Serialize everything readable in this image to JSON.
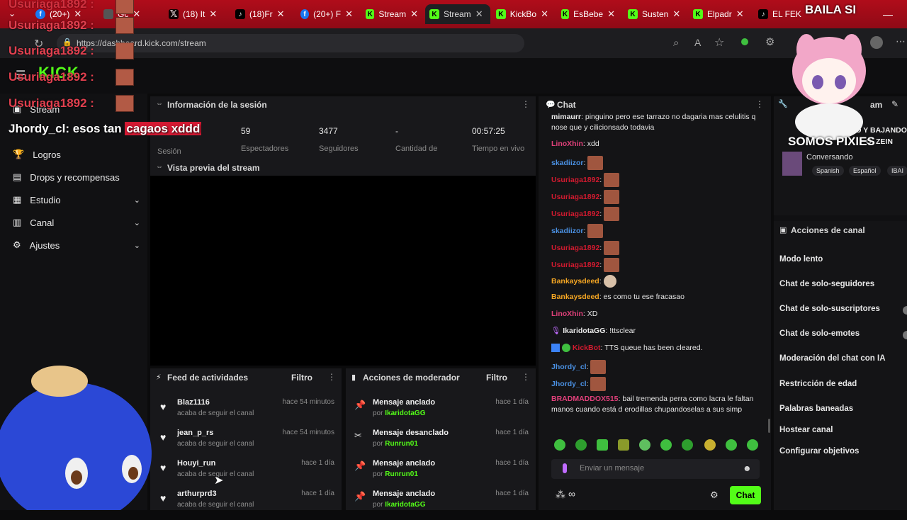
{
  "browser": {
    "tabs": [
      {
        "label": "(20+)",
        "icon": "facebook-icon"
      },
      {
        "label": "Gc",
        "icon": "generic-icon"
      },
      {
        "label": "(18) It",
        "icon": "x-icon"
      },
      {
        "label": "(18)Fr",
        "icon": "tiktok-icon"
      },
      {
        "label": "(20+) F",
        "icon": "facebook-icon"
      },
      {
        "label": "Stream",
        "icon": "kick-icon"
      },
      {
        "label": "Stream",
        "icon": "kick-icon"
      },
      {
        "label": "KickBo",
        "icon": "kick-icon"
      },
      {
        "label": "EsBebe",
        "icon": "kick-icon"
      },
      {
        "label": "Susten",
        "icon": "kick-icon"
      },
      {
        "label": "Elpadr",
        "icon": "kick-icon"
      },
      {
        "label": "EL FEK",
        "icon": "tiktok-icon"
      }
    ],
    "url": "https://dashboard.kick.com/stream"
  },
  "overlay": {
    "repeated_user": "Usuriaga1892 :",
    "jhordy_user": "Jhordy_cl",
    "jhordy_msg_part1": ": esos tan ",
    "jhordy_msg_part2": "cagaos xddd",
    "baila_si": "BAILA SI",
    "somos_pixies": "SOMOS PIXIES"
  },
  "sidebar": {
    "items": [
      {
        "label": "Stream",
        "icon": "stream-icon"
      },
      {
        "label": "Logros",
        "icon": "trophy-icon"
      },
      {
        "label": "Drops y recompensas",
        "icon": "gift-icon"
      },
      {
        "label": "Estudio",
        "icon": "studio-icon",
        "chevron": true
      },
      {
        "label": "Canal",
        "icon": "channel-icon",
        "chevron": true
      },
      {
        "label": "Ajustes",
        "icon": "gear-icon",
        "chevron": true
      }
    ]
  },
  "session": {
    "title": "Información de la sesión",
    "stats": [
      {
        "value": "59",
        "label": "Espectadores"
      },
      {
        "value": "3477",
        "label": "Seguidores"
      },
      {
        "value": "-",
        "label": "Cantidad de"
      },
      {
        "value": "00:57:25",
        "label": "Tiempo en vivo"
      }
    ],
    "first_label": "Sesión"
  },
  "preview": {
    "title": "Vista previa del stream"
  },
  "activity_feed": {
    "title": "Feed de actividades",
    "filter": "Filtro",
    "items": [
      {
        "name": "Blaz1116",
        "sub": "acaba de seguir el canal",
        "time": "hace 54 minutos"
      },
      {
        "name": "jean_p_rs",
        "sub": "acaba de seguir el canal",
        "time": "hace 54 minutos"
      },
      {
        "name": "Houyi_run",
        "sub": "acaba de seguir el canal",
        "time": "hace 1 día"
      },
      {
        "name": "arthurprd3",
        "sub": "acaba de seguir el canal",
        "time": "hace 1 día"
      }
    ]
  },
  "mod_actions": {
    "title": "Acciones de moderador",
    "filter": "Filtro",
    "items": [
      {
        "action": "Mensaje anclado",
        "by_prefix": "por",
        "by": "IkaridotaGG",
        "time": "hace 1 día",
        "icon": "pin-icon"
      },
      {
        "action": "Mensaje desanclado",
        "by_prefix": "por",
        "by": "Runrun01",
        "time": "hace 1 día",
        "icon": "unpin-icon"
      },
      {
        "action": "Mensaje anclado",
        "by_prefix": "por",
        "by": "Runrun01",
        "time": "hace 1 día",
        "icon": "pin-icon"
      },
      {
        "action": "Mensaje anclado",
        "by_prefix": "por",
        "by": "IkaridotaGG",
        "time": "hace 1 día",
        "icon": "pin-icon"
      }
    ]
  },
  "chat": {
    "title": "Chat",
    "messages": [
      {
        "user": "mimaurr",
        "color": "#e8e8e8",
        "text": "pinguino pero ese tarrazo no dagaria mas celulitis q nose que y cilicionsado todavia"
      },
      {
        "user": "LinoXhin",
        "color": "#e0407a",
        "text": "xdd"
      },
      {
        "user": "skadiizor",
        "color": "#4a90e2",
        "text": ""
      },
      {
        "user": "Usuriaga1892",
        "color": "#d11a2f",
        "text": ""
      },
      {
        "user": "Usuriaga1892",
        "color": "#d11a2f",
        "text": ""
      },
      {
        "user": "Usuriaga1892",
        "color": "#d11a2f",
        "text": ""
      },
      {
        "user": "skadiizor",
        "color": "#4a90e2",
        "text": ""
      },
      {
        "user": "Usuriaga1892",
        "color": "#d11a2f",
        "text": ""
      },
      {
        "user": "Usuriaga1892",
        "color": "#d11a2f",
        "text": ""
      },
      {
        "user": "Bankaysdeed",
        "color": "#f5a623",
        "text": ""
      },
      {
        "user": "Bankaysdeed",
        "color": "#f5a623",
        "text": "es como tu ese fracasao"
      },
      {
        "user": "LinoXhin",
        "color": "#e0407a",
        "text": "XD"
      },
      {
        "user": "IkaridotaGG",
        "color": "#e8e8e8",
        "text": "!ttsclear"
      },
      {
        "user": "KickBot",
        "color": "#d11a2f",
        "text": "TTS queue has been cleared."
      },
      {
        "user": "Jhordy_cl",
        "color": "#4a90e2",
        "text": ""
      },
      {
        "user": "Jhordy_cl",
        "color": "#4a90e2",
        "text": ""
      },
      {
        "user": "BRADMADDOX515",
        "color": "#e0407a",
        "text": "bail tremenda perra como lacra le faltan manos cuando está d erodillas chupandoselas a sus simp"
      }
    ],
    "input_placeholder": "Enviar un mensaje",
    "send_label": "Chat"
  },
  "stream_info": {
    "title_partial": "am",
    "banner": "CAYENDO Y BAJANDO",
    "banner2": "O, ZEIN",
    "category": "Conversando",
    "tags": [
      "Spanish",
      "Español",
      "IBAI"
    ]
  },
  "channel_actions": {
    "title": "Acciones de canal",
    "items": [
      {
        "label": "Modo lento"
      },
      {
        "label": "Chat de solo-seguidores"
      },
      {
        "label": "Chat de solo-suscriptores"
      },
      {
        "label": "Chat de solo-emotes"
      },
      {
        "label": "Moderación del chat con IA"
      },
      {
        "label": "Restricción de edad"
      },
      {
        "label": "Palabras baneadas"
      },
      {
        "label": "Hostear canal"
      },
      {
        "label": "Configurar objetivos"
      }
    ]
  },
  "colors": {
    "kick_green": "#53fc18",
    "tab_red": "#b00c1a",
    "panel": "#18181b"
  }
}
